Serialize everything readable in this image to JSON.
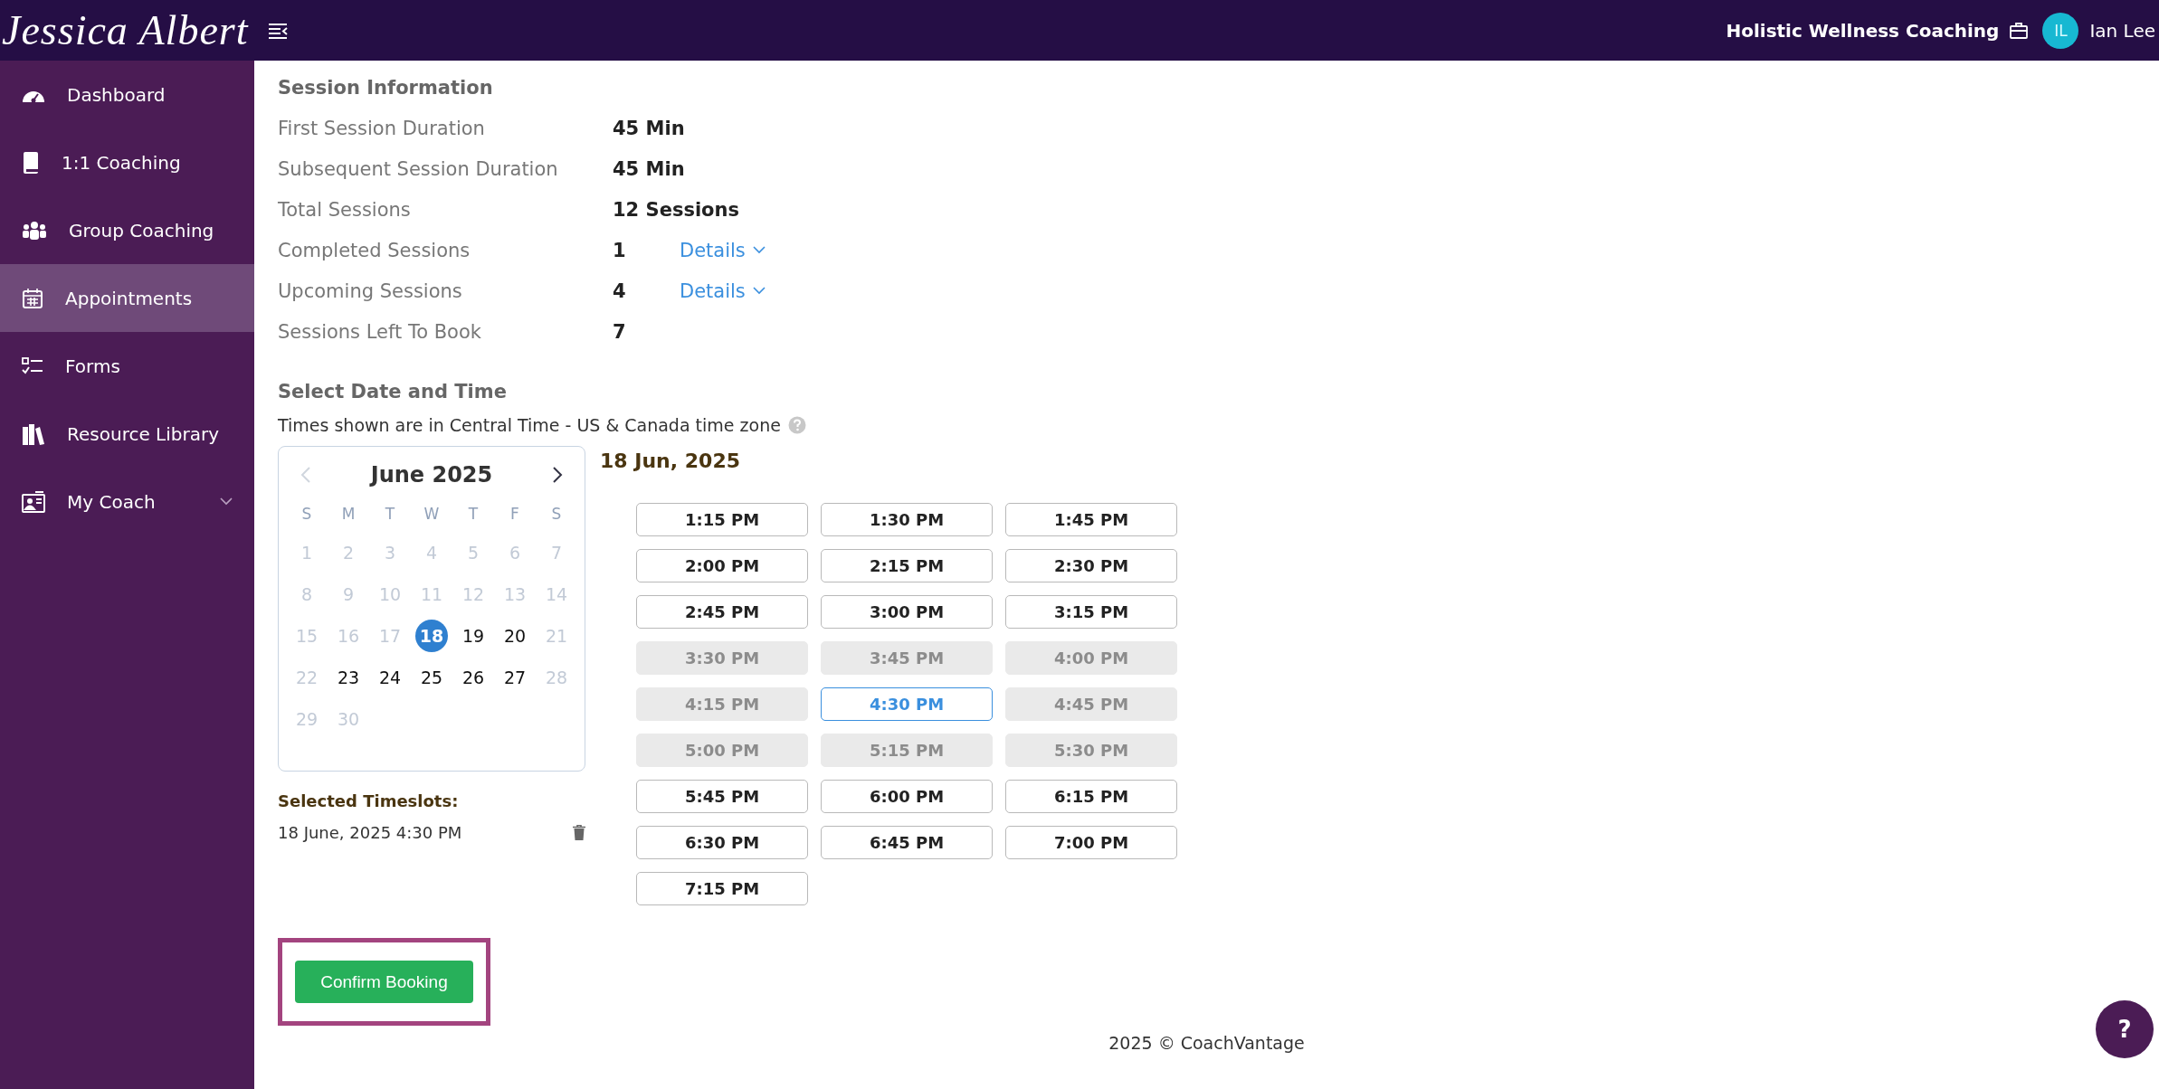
{
  "header": {
    "logo": "Jessica Albert",
    "org_name": "Holistic Wellness Coaching",
    "user_initials": "IL",
    "user_name": "Ian Lee"
  },
  "sidebar": {
    "items": [
      {
        "label": "Dashboard",
        "selected": false,
        "expandable": false
      },
      {
        "label": "1:1 Coaching",
        "selected": false,
        "expandable": false
      },
      {
        "label": "Group Coaching",
        "selected": false,
        "expandable": false
      },
      {
        "label": "Appointments",
        "selected": true,
        "expandable": false
      },
      {
        "label": "Forms",
        "selected": false,
        "expandable": false
      },
      {
        "label": "Resource Library",
        "selected": false,
        "expandable": false
      },
      {
        "label": "My Coach",
        "selected": false,
        "expandable": true
      }
    ]
  },
  "session_info": {
    "title": "Session Information",
    "rows": [
      {
        "label": "First Session Duration",
        "value": "45 Min"
      },
      {
        "label": "Subsequent Session Duration",
        "value": "45 Min"
      },
      {
        "label": "Total Sessions",
        "value": "12 Sessions"
      },
      {
        "label": "Completed Sessions",
        "value": "1",
        "link": "Details"
      },
      {
        "label": "Upcoming Sessions",
        "value": "4",
        "link": "Details"
      },
      {
        "label": "Sessions Left To Book",
        "value": "7"
      }
    ]
  },
  "booking": {
    "title": "Select Date and Time",
    "timezone_note": "Times shown are in Central Time - US & Canada time zone",
    "calendar": {
      "month": "June 2025",
      "weekdays": [
        "S",
        "M",
        "T",
        "W",
        "T",
        "F",
        "S"
      ],
      "days": [
        {
          "day": "1",
          "disabled": true,
          "selected": false
        },
        {
          "day": "2",
          "disabled": true,
          "selected": false
        },
        {
          "day": "3",
          "disabled": true,
          "selected": false
        },
        {
          "day": "4",
          "disabled": true,
          "selected": false
        },
        {
          "day": "5",
          "disabled": true,
          "selected": false
        },
        {
          "day": "6",
          "disabled": true,
          "selected": false
        },
        {
          "day": "7",
          "disabled": true,
          "selected": false
        },
        {
          "day": "8",
          "disabled": true,
          "selected": false
        },
        {
          "day": "9",
          "disabled": true,
          "selected": false
        },
        {
          "day": "10",
          "disabled": true,
          "selected": false
        },
        {
          "day": "11",
          "disabled": true,
          "selected": false
        },
        {
          "day": "12",
          "disabled": true,
          "selected": false
        },
        {
          "day": "13",
          "disabled": true,
          "selected": false
        },
        {
          "day": "14",
          "disabled": true,
          "selected": false
        },
        {
          "day": "15",
          "disabled": true,
          "selected": false
        },
        {
          "day": "16",
          "disabled": true,
          "selected": false
        },
        {
          "day": "17",
          "disabled": true,
          "selected": false
        },
        {
          "day": "18",
          "disabled": false,
          "selected": true
        },
        {
          "day": "19",
          "disabled": false,
          "selected": false
        },
        {
          "day": "20",
          "disabled": false,
          "selected": false
        },
        {
          "day": "21",
          "disabled": true,
          "selected": false
        },
        {
          "day": "22",
          "disabled": true,
          "selected": false
        },
        {
          "day": "23",
          "disabled": false,
          "selected": false
        },
        {
          "day": "24",
          "disabled": false,
          "selected": false
        },
        {
          "day": "25",
          "disabled": false,
          "selected": false
        },
        {
          "day": "26",
          "disabled": false,
          "selected": false
        },
        {
          "day": "27",
          "disabled": false,
          "selected": false
        },
        {
          "day": "28",
          "disabled": true,
          "selected": false
        },
        {
          "day": "29",
          "disabled": true,
          "selected": false
        },
        {
          "day": "30",
          "disabled": true,
          "selected": false
        }
      ]
    },
    "date_heading": "18 Jun, 2025",
    "slots": [
      {
        "time": "1:15 PM",
        "disabled": false,
        "selected": false
      },
      {
        "time": "1:30 PM",
        "disabled": false,
        "selected": false
      },
      {
        "time": "1:45 PM",
        "disabled": false,
        "selected": false
      },
      {
        "time": "2:00 PM",
        "disabled": false,
        "selected": false
      },
      {
        "time": "2:15 PM",
        "disabled": false,
        "selected": false
      },
      {
        "time": "2:30 PM",
        "disabled": false,
        "selected": false
      },
      {
        "time": "2:45 PM",
        "disabled": false,
        "selected": false
      },
      {
        "time": "3:00 PM",
        "disabled": false,
        "selected": false
      },
      {
        "time": "3:15 PM",
        "disabled": false,
        "selected": false
      },
      {
        "time": "3:30 PM",
        "disabled": true,
        "selected": false
      },
      {
        "time": "3:45 PM",
        "disabled": true,
        "selected": false
      },
      {
        "time": "4:00 PM",
        "disabled": true,
        "selected": false
      },
      {
        "time": "4:15 PM",
        "disabled": true,
        "selected": false
      },
      {
        "time": "4:30 PM",
        "disabled": false,
        "selected": true
      },
      {
        "time": "4:45 PM",
        "disabled": true,
        "selected": false
      },
      {
        "time": "5:00 PM",
        "disabled": true,
        "selected": false
      },
      {
        "time": "5:15 PM",
        "disabled": true,
        "selected": false
      },
      {
        "time": "5:30 PM",
        "disabled": true,
        "selected": false
      },
      {
        "time": "5:45 PM",
        "disabled": false,
        "selected": false
      },
      {
        "time": "6:00 PM",
        "disabled": false,
        "selected": false
      },
      {
        "time": "6:15 PM",
        "disabled": false,
        "selected": false
      },
      {
        "time": "6:30 PM",
        "disabled": false,
        "selected": false
      },
      {
        "time": "6:45 PM",
        "disabled": false,
        "selected": false
      },
      {
        "time": "7:00 PM",
        "disabled": false,
        "selected": false
      },
      {
        "time": "7:15 PM",
        "disabled": false,
        "selected": false
      }
    ],
    "selected_timeslots": {
      "title": "Selected Timeslots:",
      "items": [
        "18 June, 2025 4:30 PM"
      ]
    },
    "confirm_button": {
      "label": "Confirm Booking",
      "highlighted": true
    }
  },
  "footer": "2025 © CoachVantage",
  "help_button": "?"
}
